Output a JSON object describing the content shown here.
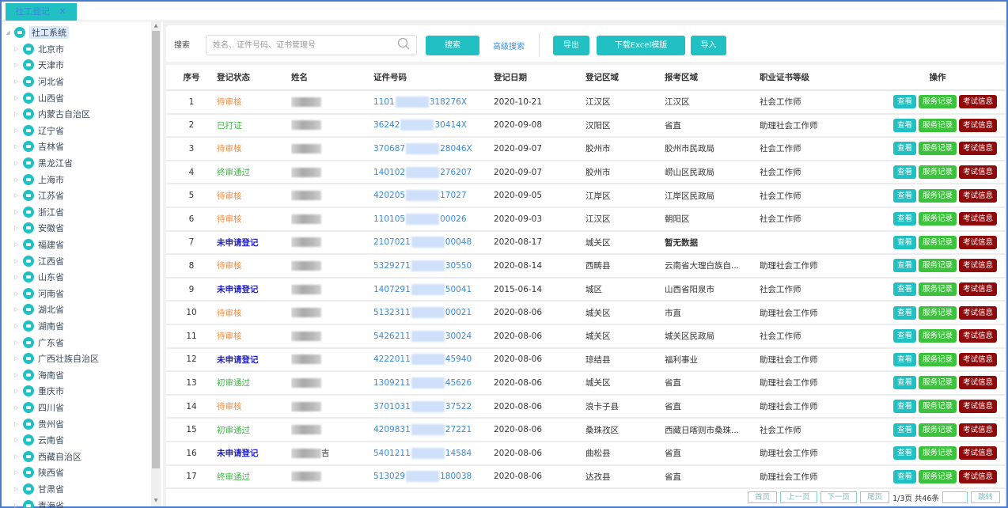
{
  "tab": {
    "label": "社工登记",
    "close": "✕"
  },
  "tree": {
    "root": "社工系统",
    "children": [
      "北京市",
      "天津市",
      "河北省",
      "山西省",
      "内蒙古自治区",
      "辽宁省",
      "吉林省",
      "黑龙江省",
      "上海市",
      "江苏省",
      "浙江省",
      "安徽省",
      "福建省",
      "江西省",
      "山东省",
      "河南省",
      "湖北省",
      "湖南省",
      "广东省",
      "广西壮族自治区",
      "海南省",
      "重庆市",
      "四川省",
      "贵州省",
      "云南省",
      "西藏自治区",
      "陕西省",
      "甘肃省",
      "青海省"
    ]
  },
  "toolbar": {
    "search_label": "搜索",
    "search_placeholder": "姓名、证件号码、证书管理号",
    "search_button": "搜索",
    "advanced_search": "高级搜索",
    "export": "导出",
    "download_template": "下载Excel模版",
    "import": "导入"
  },
  "table": {
    "headers": [
      "序号",
      "登记状态",
      "姓名",
      "证件号码",
      "登记日期",
      "登记区域",
      "报考区域",
      "职业证书等级",
      "操作"
    ],
    "actions": {
      "view": "查看",
      "service": "服务记录",
      "exam": "考试信息"
    },
    "rows": [
      {
        "idx": "1",
        "status": "待审核",
        "status_type": "pending",
        "name_suffix": "",
        "id_prefix": "1101",
        "id_suffix": "318276X",
        "date": "2020-10-21",
        "reg_area": "江汉区",
        "exam_area": "江汉区",
        "level": "社会工作师"
      },
      {
        "idx": "2",
        "status": "已打证",
        "status_type": "green",
        "name_suffix": "",
        "id_prefix": "36242",
        "id_suffix": "30414X",
        "date": "2020-09-08",
        "reg_area": "汉阳区",
        "exam_area": "省直",
        "level": "助理社会工作师"
      },
      {
        "idx": "3",
        "status": "待审核",
        "status_type": "pending",
        "name_suffix": "",
        "id_prefix": "370687",
        "id_suffix": "28046X",
        "date": "2020-09-07",
        "reg_area": "胶州市",
        "exam_area": "胶州市民政局",
        "level": "社会工作师"
      },
      {
        "idx": "4",
        "status": "终审通过",
        "status_type": "green",
        "name_suffix": "",
        "id_prefix": "140102",
        "id_suffix": "276207",
        "date": "2020-09-07",
        "reg_area": "胶州市",
        "exam_area": "崂山区民政局",
        "level": "社会工作师"
      },
      {
        "idx": "5",
        "status": "待审核",
        "status_type": "pending",
        "name_suffix": "",
        "id_prefix": "420205",
        "id_suffix": "17027",
        "date": "2020-09-05",
        "reg_area": "江岸区",
        "exam_area": "江岸区民政局",
        "level": "社会工作师"
      },
      {
        "idx": "6",
        "status": "待审核",
        "status_type": "pending",
        "name_suffix": "",
        "id_prefix": "110105",
        "id_suffix": "00026",
        "date": "2020-09-03",
        "reg_area": "江汉区",
        "exam_area": "朝阳区",
        "level": "社会工作师"
      },
      {
        "idx": "7",
        "status": "未申请登记",
        "status_type": "blue",
        "name_suffix": "",
        "id_prefix": "2107021",
        "id_suffix": "00048",
        "date": "2020-08-17",
        "reg_area": "城关区",
        "exam_area": "暂无数据",
        "exam_bold": true,
        "level": ""
      },
      {
        "idx": "8",
        "status": "待审核",
        "status_type": "pending",
        "name_suffix": "",
        "id_prefix": "5329271",
        "id_suffix": "30550",
        "date": "2020-08-14",
        "reg_area": "西畴县",
        "exam_area": "云南省大理白族自...",
        "level": "助理社会工作师"
      },
      {
        "idx": "9",
        "status": "未申请登记",
        "status_type": "blue",
        "name_suffix": "",
        "id_prefix": "1407291",
        "id_suffix": "50041",
        "date": "2015-06-14",
        "reg_area": "城区",
        "exam_area": "山西省阳泉市",
        "level": "社会工作师"
      },
      {
        "idx": "10",
        "status": "待审核",
        "status_type": "pending",
        "name_suffix": "",
        "id_prefix": "5132311",
        "id_suffix": "00021",
        "date": "2020-08-06",
        "reg_area": "城关区",
        "exam_area": "市直",
        "level": "助理社会工作师"
      },
      {
        "idx": "11",
        "status": "待审核",
        "status_type": "pending",
        "name_suffix": "",
        "id_prefix": "5426211",
        "id_suffix": "30024",
        "date": "2020-08-06",
        "reg_area": "城关区",
        "exam_area": "城关区民政局",
        "level": "社会工作师"
      },
      {
        "idx": "12",
        "status": "未申请登记",
        "status_type": "blue",
        "name_suffix": "",
        "id_prefix": "4222011",
        "id_suffix": "45940",
        "date": "2020-08-06",
        "reg_area": "琼结县",
        "exam_area": "福利事业",
        "level": "助理社会工作师"
      },
      {
        "idx": "13",
        "status": "初审通过",
        "status_type": "green",
        "name_suffix": "",
        "id_prefix": "1309211",
        "id_suffix": "45626",
        "date": "2020-08-06",
        "reg_area": "城关区",
        "exam_area": "省直",
        "level": "助理社会工作师"
      },
      {
        "idx": "14",
        "status": "待审核",
        "status_type": "pending",
        "name_suffix": "",
        "id_prefix": "3701031",
        "id_suffix": "37522",
        "date": "2020-08-06",
        "reg_area": "浪卡子县",
        "exam_area": "省直",
        "level": "助理社会工作师"
      },
      {
        "idx": "15",
        "status": "初审通过",
        "status_type": "green",
        "name_suffix": "",
        "id_prefix": "4209831",
        "id_suffix": "27221",
        "date": "2020-08-06",
        "reg_area": "桑珠孜区",
        "exam_area": "西藏日喀则市桑珠...",
        "level": "社会工作师"
      },
      {
        "idx": "16",
        "status": "未申请登记",
        "status_type": "blue",
        "name_suffix": "吉",
        "id_prefix": "5401211",
        "id_suffix": "14584",
        "date": "2020-08-06",
        "reg_area": "曲松县",
        "exam_area": "省直",
        "level": "助理社会工作师"
      },
      {
        "idx": "17",
        "status": "终审通过",
        "status_type": "green",
        "name_suffix": "",
        "id_prefix": "513029",
        "id_suffix": "180038",
        "date": "2020-08-06",
        "reg_area": "达孜县",
        "exam_area": "省直",
        "level": "助理社会工作师"
      }
    ]
  },
  "pager": {
    "first": "首页",
    "prev": "上一页",
    "next": "下一页",
    "last": "尾页",
    "info": "1/3页 共46条",
    "jump": "跳转"
  }
}
